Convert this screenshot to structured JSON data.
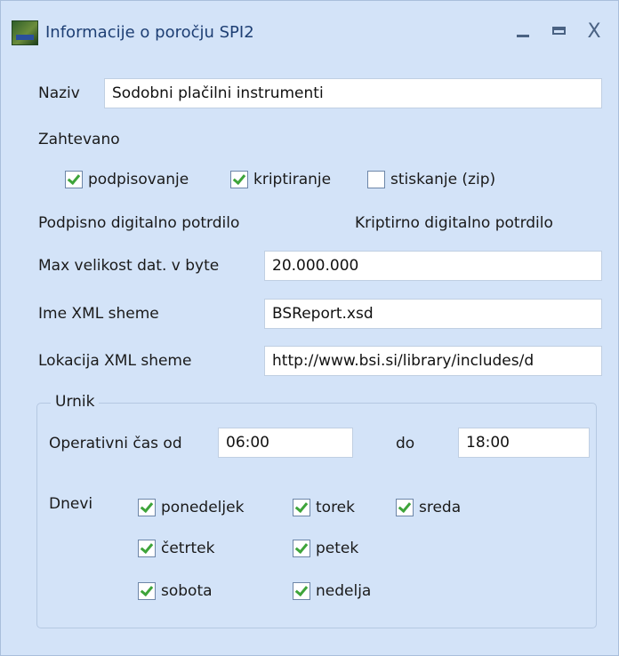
{
  "window": {
    "title": "Informacije o poročju SPI2",
    "controls": {
      "minimize": "_",
      "maximize": "□",
      "close": "X"
    }
  },
  "form": {
    "naziv_label": "Naziv",
    "naziv_value": "Sodobni plačilni instrumenti",
    "zahtevano_label": "Zahtevano",
    "zahtevano": {
      "podpisovanje": {
        "label": "podpisovanje",
        "checked": true
      },
      "kriptiranje": {
        "label": "kriptiranje",
        "checked": true
      },
      "stiskanje": {
        "label": "stiskanje (zip)",
        "checked": false
      }
    },
    "podpisno_label": "Podpisno digitalno potrdilo",
    "kriptirno_label": "Kriptirno digitalno potrdilo",
    "max_label": "Max velikost dat. v byte",
    "max_value": "20.000.000",
    "ime_xml_label": "Ime XML sheme",
    "ime_xml_value": "BSReport.xsd",
    "lokacija_label": "Lokacija XML sheme",
    "lokacija_value": "http://www.bsi.si/library/includes/d"
  },
  "urnik": {
    "title": "Urnik",
    "od_label": "Operativni čas od",
    "od_value": "06:00",
    "do_label": "do",
    "do_value": "18:00",
    "dnevi_label": "Dnevi",
    "days": {
      "ponedeljek": {
        "label": "ponedeljek",
        "checked": true
      },
      "torek": {
        "label": "torek",
        "checked": true
      },
      "sreda": {
        "label": "sreda",
        "checked": true
      },
      "cetrtek": {
        "label": "četrtek",
        "checked": true
      },
      "petek": {
        "label": "petek",
        "checked": true
      },
      "sobota": {
        "label": "sobota",
        "checked": true
      },
      "nedelja": {
        "label": "nedelja",
        "checked": true
      }
    }
  },
  "icons": {
    "app": "app-icon",
    "check": "checkmark-icon"
  },
  "colors": {
    "background": "#d3e3f8",
    "title_text": "#1e3f74",
    "checkmark": "#3ea43a"
  }
}
